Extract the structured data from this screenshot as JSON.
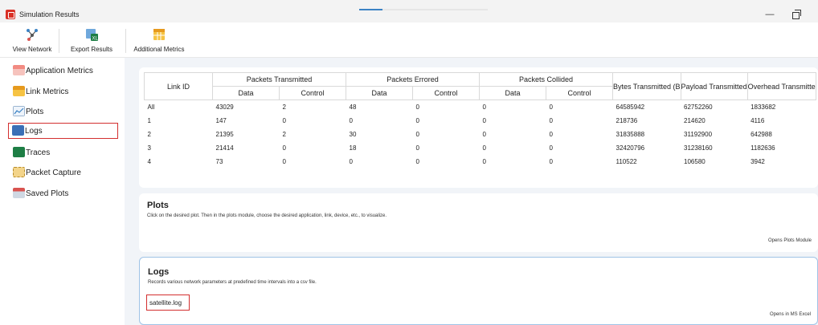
{
  "window": {
    "title": "Simulation Results",
    "minimize": "—"
  },
  "toolbar": {
    "view_network": "View Network",
    "export_results": "Export Results",
    "additional_metrics": "Additional Metrics",
    "loading_progress": 0.18
  },
  "sidebar": {
    "items": [
      {
        "label": "Application Metrics",
        "icon": "application-metrics-icon"
      },
      {
        "label": "Link Metrics",
        "icon": "link-metrics-icon"
      },
      {
        "label": "Plots",
        "icon": "plots-icon"
      },
      {
        "label": "Logs",
        "icon": "logs-icon"
      },
      {
        "label": "Traces",
        "icon": "traces-icon"
      },
      {
        "label": "Packet Capture",
        "icon": "packet-capture-icon"
      },
      {
        "label": "Saved Plots",
        "icon": "saved-plots-icon"
      }
    ],
    "selected": "Logs"
  },
  "table": {
    "link_id": "Link ID",
    "groups": [
      "Packets Transmitted",
      "Packets Errored",
      "Packets Collided"
    ],
    "sub": [
      "Data",
      "Control"
    ],
    "extra_headers": [
      "Bytes Transmitted (B",
      "Payload Transmitted",
      "Overhead Transmitte"
    ],
    "rows": [
      [
        "All",
        "43029",
        "2",
        "48",
        "0",
        "0",
        "0",
        "64585942",
        "62752260",
        "1833682"
      ],
      [
        "1",
        "147",
        "0",
        "0",
        "0",
        "0",
        "0",
        "218736",
        "214620",
        "4116"
      ],
      [
        "2",
        "21395",
        "2",
        "30",
        "0",
        "0",
        "0",
        "31835888",
        "31192900",
        "642988"
      ],
      [
        "3",
        "21414",
        "0",
        "18",
        "0",
        "0",
        "0",
        "32420796",
        "31238160",
        "1182636"
      ],
      [
        "4",
        "73",
        "0",
        "0",
        "0",
        "0",
        "0",
        "110522",
        "106580",
        "3942"
      ]
    ]
  },
  "plots_panel": {
    "title": "Plots",
    "description": "Click on the desired plot. Then in the plots module, choose the desired application, link, device, etc., to visualize.",
    "footer": "Opens Plots Module"
  },
  "logs_panel": {
    "title": "Logs",
    "description": "Records various network parameters at predefined time intervals into a csv file.",
    "file": "satellite.log",
    "footer": "Opens in MS Excel"
  },
  "colors": {
    "accent_red": "#d32f2f",
    "content_bg": "#f1f4f8",
    "logs_border": "#9fc3e6"
  }
}
